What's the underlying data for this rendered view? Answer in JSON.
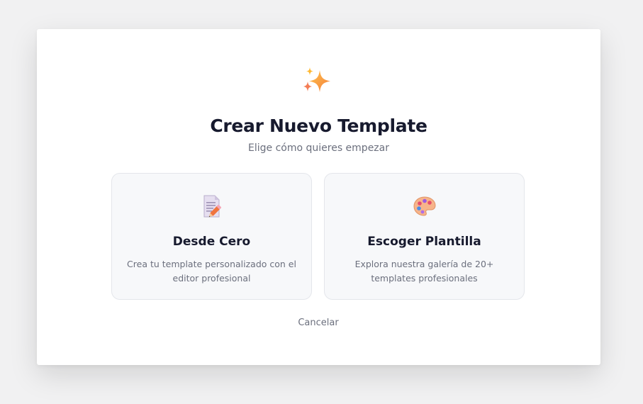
{
  "dialog": {
    "icon": "sparkles-icon",
    "title": "Crear Nuevo Template",
    "subtitle": "Elige cómo quieres empezar",
    "cancel_label": "Cancelar"
  },
  "options": [
    {
      "icon": "memo-icon",
      "title": "Desde Cero",
      "description": "Crea tu template personalizado con el editor profesional"
    },
    {
      "icon": "palette-icon",
      "title": "Escoger Plantilla",
      "description": "Explora nuestra galería de 20+ templates profesionales"
    }
  ],
  "colors": {
    "background": "#f1f1f2",
    "modal": "#ffffff",
    "card": "#f7f8fa",
    "title": "#171a2e",
    "muted": "#6b6f7d"
  }
}
